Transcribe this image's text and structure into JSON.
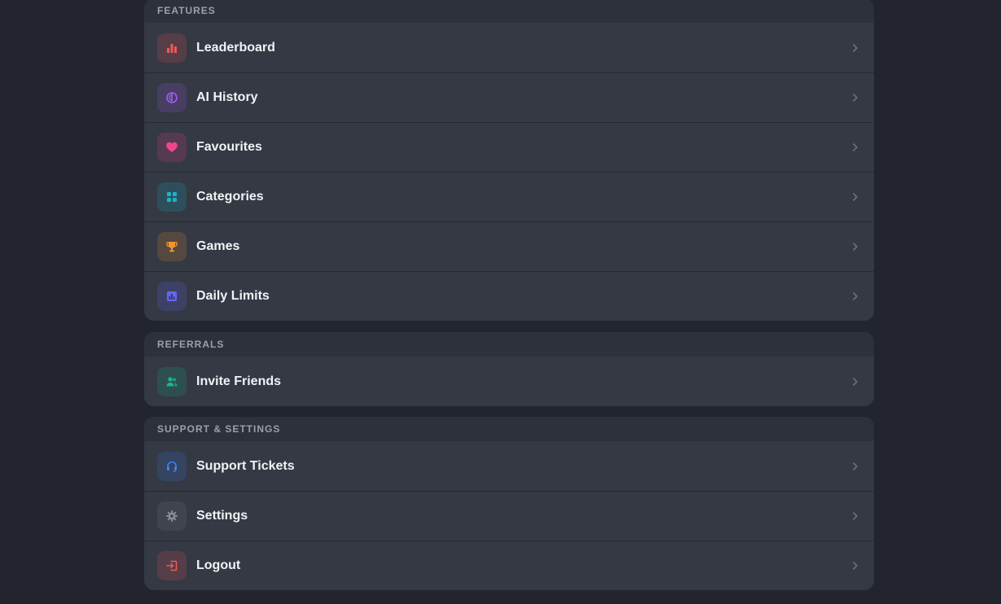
{
  "sections": [
    {
      "title": "FEATURES",
      "items": [
        {
          "label": "Leaderboard",
          "icon": "bar-chart-icon",
          "color": "#ef5a5a"
        },
        {
          "label": "AI History",
          "icon": "brain-icon",
          "color": "#a35bf0"
        },
        {
          "label": "Favourites",
          "icon": "heart-icon",
          "color": "#f0458f"
        },
        {
          "label": "Categories",
          "icon": "grid-icon",
          "color": "#19b3c9"
        },
        {
          "label": "Games",
          "icon": "trophy-icon",
          "color": "#f0962a"
        },
        {
          "label": "Daily Limits",
          "icon": "chart-square-icon",
          "color": "#6366f1"
        }
      ]
    },
    {
      "title": "REFERRALS",
      "items": [
        {
          "label": "Invite Friends",
          "icon": "users-icon",
          "color": "#15b88a"
        }
      ]
    },
    {
      "title": "SUPPORT & SETTINGS",
      "items": [
        {
          "label": "Support Tickets",
          "icon": "headset-icon",
          "color": "#3b82f6"
        },
        {
          "label": "Settings",
          "icon": "gear-icon",
          "color": "#8b8f98"
        },
        {
          "label": "Logout",
          "icon": "logout-icon",
          "color": "#ef5a5a"
        }
      ]
    }
  ],
  "colors": {
    "background": "#22252d",
    "card": "#343944",
    "header": "#2d313a",
    "text": "#f1f2f4",
    "muted": "#9aa0aa",
    "chevron": "#6b7079"
  }
}
